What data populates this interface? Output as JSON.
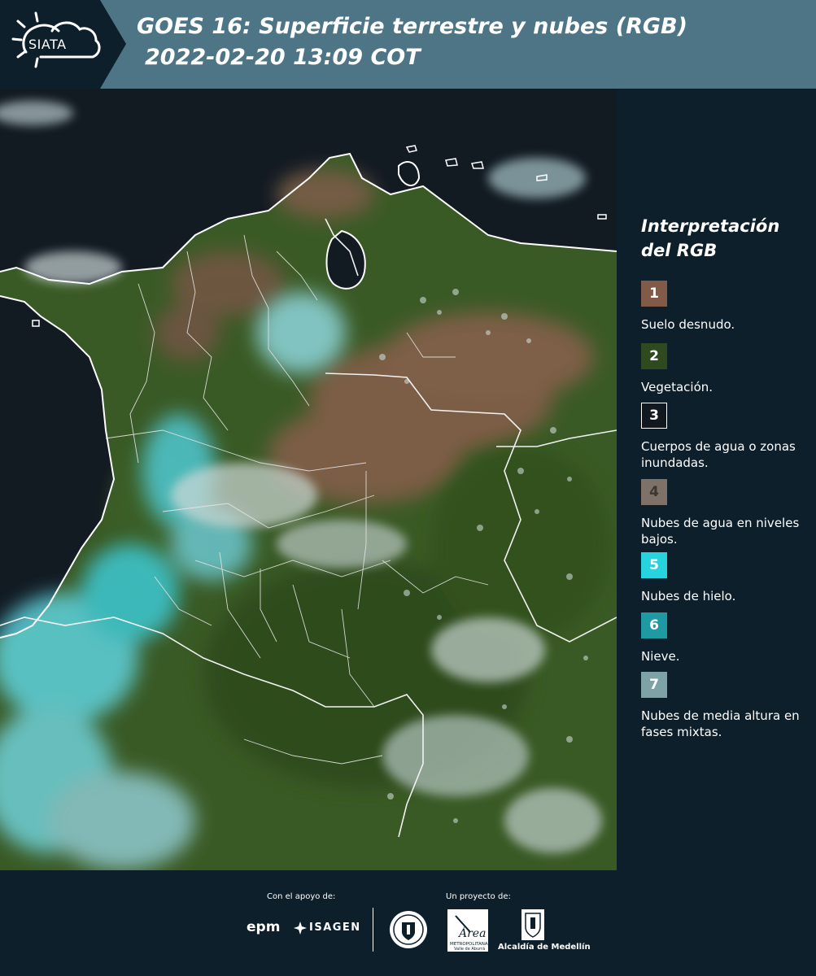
{
  "header": {
    "brand": "SIATA",
    "title_line1": "GOES 16: Superficie terrestre y nubes (RGB)",
    "title_line2": "2022-02-20 13:09 COT"
  },
  "legend": {
    "title": "Interpretación del RGB",
    "items": [
      {
        "number": "1",
        "label": "Suelo desnudo.",
        "color": "#825a48"
      },
      {
        "number": "2",
        "label": "Vegetación.",
        "color": "#2e4a1e"
      },
      {
        "number": "3",
        "label": "Cuerpos de agua o zonas inundadas.",
        "color": "#121820"
      },
      {
        "number": "4",
        "label": "Nubes de agua en niveles bajos.",
        "color": "#7d7168"
      },
      {
        "number": "5",
        "label": "Nubes de hielo.",
        "color": "#27d3dc"
      },
      {
        "number": "6",
        "label": "Nieve.",
        "color": "#1f9aa3"
      },
      {
        "number": "7",
        "label": "Nubes de media altura en fases mixtas.",
        "color": "#7ea3a6"
      }
    ]
  },
  "footer": {
    "support_label": "Con el apoyo de:",
    "project_label": "Un proyecto de:",
    "sponsors": [
      "epm",
      "ISAGEN"
    ],
    "area_name": "Área",
    "area_subtitle": "METROPOLITANA",
    "area_subtitle2": "Valle de Aburrá",
    "alcaldia": "Alcaldía de Medellín"
  },
  "colors": {
    "header_bg": "#4d7585",
    "dark_bg": "#0c1f2b",
    "ocean": "#121a22",
    "vegetation": "#3e5e26",
    "bare_soil": "#7b5d45",
    "ice_cloud": "#3ec9d4"
  }
}
